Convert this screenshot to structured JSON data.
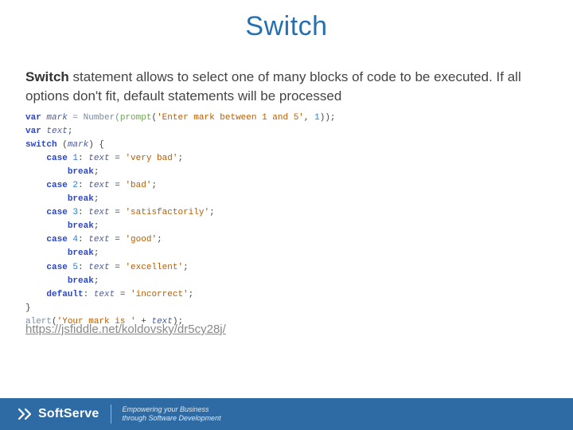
{
  "title": "Switch",
  "description_bold": "Switch",
  "description_rest": " statement allows to select one of many blocks of code to be executed. If all options don't fit, default statements will be processed",
  "code": {
    "l1a": "var",
    "l1b": "mark",
    "l1c": " = Number(",
    "l1d": "prompt",
    "l1e": "(",
    "l1f": "'Enter mark between 1 and 5'",
    "l1g": ", ",
    "l1h": "1",
    "l1i": "));",
    "l2a": "var",
    "l2b": "text",
    "l2c": ";",
    "l3a": "switch",
    "l3b": " (",
    "l3c": "mark",
    "l3d": ") {",
    "c1a": "case",
    "c1b": "1",
    "c1c": ": ",
    "c1d": "text",
    "c1e": " = ",
    "c1f": "'very bad'",
    "c1g": ";",
    "brk": "break",
    "semi": ";",
    "c2a": "case",
    "c2b": "2",
    "c2d": "text",
    "c2f": "'bad'",
    "c3a": "case",
    "c3b": "3",
    "c3d": "text",
    "c3f": "'satisfactorily'",
    "c4a": "case",
    "c4b": "4",
    "c4d": "text",
    "c4f": "'good'",
    "c5a": "case",
    "c5b": "5",
    "c5d": "text",
    "c5f": "'excellent'",
    "dfa": "default",
    "dfb": ": ",
    "dfc": "text",
    "dfd": " = ",
    "dfe": "'incorrect'",
    "dff": ";",
    "end": "}",
    "al1": "alert",
    "al2": "(",
    "al3": "'Your mark is '",
    "al4": " + ",
    "al5": "text",
    "al6": ");"
  },
  "link_text": "https://jsfiddle.net/koldovsky/dr5cy28j/",
  "footer": {
    "brand": "SoftServe",
    "tagline1": "Empowering your Business",
    "tagline2": "through Software Development"
  }
}
